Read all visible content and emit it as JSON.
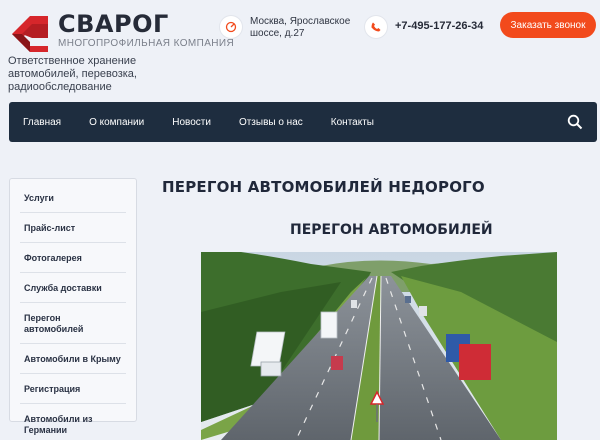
{
  "brand": {
    "name": "СВАРОГ",
    "subtitle": "МНОГОПРОФИЛЬНАЯ КОМПАНИЯ",
    "tagline": "Ответственное хранение автомобилей, перевозка, радиообследование"
  },
  "contacts": {
    "address": "Москва, Ярославское шоссе, д.27",
    "phone": "+7-495-177-26-34",
    "callback_label": "Заказать звонок"
  },
  "nav": {
    "items": [
      "Главная",
      "О компании",
      "Новости",
      "Отзывы о нас",
      "Контакты"
    ],
    "search_icon": "search-icon"
  },
  "sidebar": {
    "items": [
      "Услуги",
      "Прайс-лист",
      "Фотогалерея",
      "Служба доставки",
      "Перегон автомобилей",
      "Автомобили в Крыму",
      "Регистрация",
      "Автомобили из Германии"
    ]
  },
  "main": {
    "title": "ПЕРЕГОН АВТОМОБИЛЕЙ НЕДОРОГО",
    "subtitle": "ПЕРЕГОН  АВТОМОБИЛЕЙ"
  },
  "colors": {
    "accent": "#f24a1c",
    "nav_bg": "#1e2d3f",
    "logo_red": "#d6262b",
    "page_bg": "#eef1f7"
  }
}
